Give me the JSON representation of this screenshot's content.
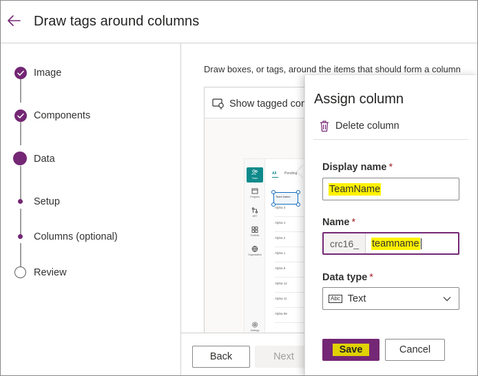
{
  "header": {
    "title": "Draw tags around columns"
  },
  "steps": [
    {
      "label": "Image",
      "state": "complete"
    },
    {
      "label": "Components",
      "state": "complete"
    },
    {
      "label": "Data",
      "state": "current"
    },
    {
      "label": "Setup",
      "state": "substep"
    },
    {
      "label": "Columns (optional)",
      "state": "substep"
    },
    {
      "label": "Review",
      "state": "upcoming"
    }
  ],
  "main": {
    "instruction": "Draw boxes, or tags, around the items that should form a column",
    "show_tagged_label": "Show tagged content"
  },
  "preview": {
    "tabs": [
      "All",
      "Pending"
    ],
    "rail": [
      "Team",
      "Program",
      "ART",
      "Portfolio",
      "Organization",
      "Settings"
    ],
    "tagged_label": "Team Name",
    "rows": [
      "Alpha 3",
      "Alpha 4",
      "Alpha 2",
      "Alpha 1",
      "Alpha 8",
      "Alpha 12",
      "Alpha 11",
      "Alpha 89"
    ]
  },
  "footer": {
    "back_label": "Back",
    "next_label": "Next"
  },
  "pane": {
    "title": "Assign column",
    "delete_label": "Delete column",
    "display_name": {
      "label": "Display name",
      "required_mark": "*",
      "value": "TeamName"
    },
    "name": {
      "label": "Name",
      "required_mark": "*",
      "prefix": "crc16_",
      "value": "teamname"
    },
    "data_type": {
      "label": "Data type",
      "required_mark": "*",
      "type_icon_text": "Abc",
      "value": "Text"
    },
    "save_label": "Save",
    "cancel_label": "Cancel"
  },
  "colors": {
    "accent": "#742774",
    "highlight": "#fff200",
    "tag_blue": "#0f6cbd",
    "preview_teal": "#0f8a8c"
  }
}
